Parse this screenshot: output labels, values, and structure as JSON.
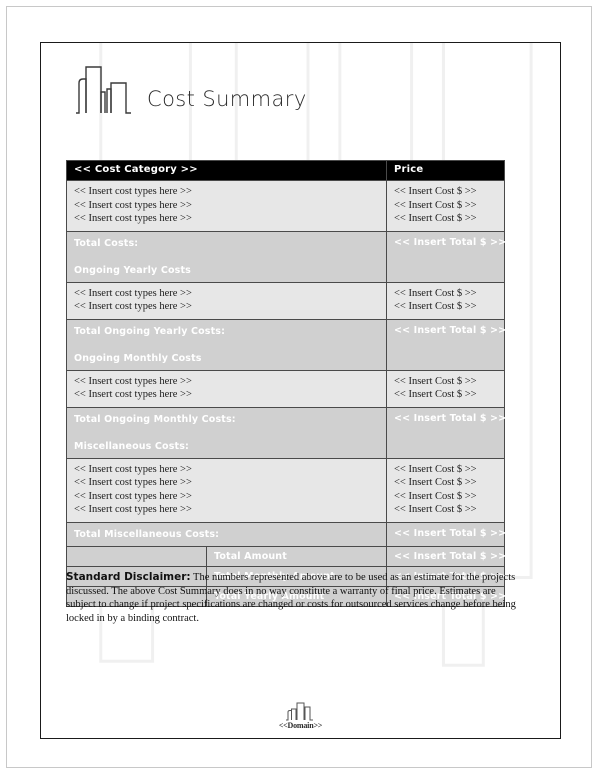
{
  "document": {
    "title": "Cost Summary",
    "logo_icon": "city-skyline-icon"
  },
  "table": {
    "headers": {
      "category": "<< Cost Category >>",
      "price": "Price"
    },
    "item_placeholder": "<< Insert cost types here >>",
    "cost_placeholder": "<< Insert Cost $ >>",
    "total_placeholder": "<< Insert Total $ >>",
    "sections": [
      {
        "items": [
          "<< Insert cost types here >>",
          "<< Insert cost types here >>",
          "<< Insert cost types here >>"
        ],
        "costs": [
          "<< Insert Cost $ >>",
          "<< Insert Cost $ >>",
          "<< Insert Cost $ >>"
        ],
        "total_label": "Total Costs:",
        "next_section_label": "Ongoing Yearly Costs",
        "total_value": "<< Insert Total $ >>"
      },
      {
        "items": [
          "<< Insert cost types here >>",
          "<< Insert cost types here >>"
        ],
        "costs": [
          "<< Insert Cost $ >>",
          "<< Insert Cost $ >>"
        ],
        "total_label": "Total Ongoing Yearly Costs:",
        "next_section_label": "Ongoing Monthly Costs",
        "total_value": "<< Insert Total $ >>"
      },
      {
        "items": [
          "<< Insert cost types here >>",
          "<< Insert cost types here >>"
        ],
        "costs": [
          "<< Insert Cost $ >>",
          "<< Insert Cost $ >>"
        ],
        "total_label": "Total Ongoing Monthly Costs:",
        "next_section_label": "Miscellaneous Costs:",
        "total_value": "<< Insert Total $ >>"
      },
      {
        "items": [
          "<< Insert cost types here >>",
          "<< Insert cost types here >>",
          "<< Insert cost types here >>",
          "<< Insert cost types here >>"
        ],
        "costs": [
          "<< Insert Cost $ >>",
          "<< Insert Cost $ >>",
          "<< Insert Cost $ >>",
          "<< Insert Cost $ >>"
        ],
        "total_label": "Total Miscellaneous Costs:",
        "next_section_label": "",
        "total_value": "<< Insert Total $ >>"
      }
    ],
    "grand_totals": [
      {
        "label": "Total Amount",
        "value": "<< Insert Total $ >>"
      },
      {
        "label": "Total Monthly Amount",
        "value": "<< Insert Total $ >>"
      },
      {
        "label": "Total Yearly Amount",
        "value": "<< Insert Total $ >>"
      }
    ]
  },
  "disclaimer": {
    "heading": "Standard Disclaimer:",
    "body": " The numbers represented above are to be used as an estimate for the projects discussed. The above Cost Summary does in no way constitute a warranty of final price.  Estimates are subject to change if project specifications are changed or costs for outsourced services change before being locked in by a binding contract."
  },
  "footer": {
    "mark_icon": "city-skyline-icon",
    "text": "<<Domain>>"
  },
  "colors": {
    "header_bg": "#000000",
    "header_text": "#ffffff",
    "item_row_bg": "#e7e7e7",
    "total_row_bg": "#d0d0d0",
    "total_row_text": "#ffffff",
    "border": "#4a4a4a",
    "page_border": "#1a1a1a",
    "watermark": "#f2f2f2"
  }
}
